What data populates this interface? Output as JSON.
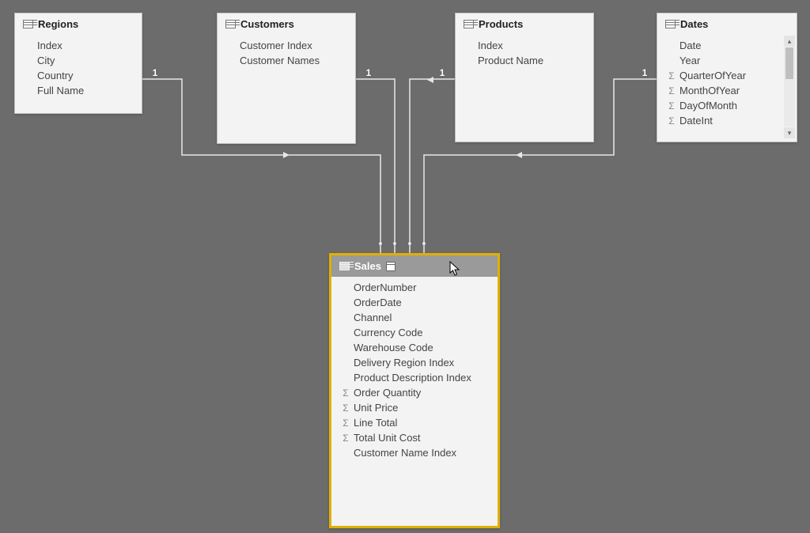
{
  "tables": {
    "regions": {
      "title": "Regions",
      "fields": [
        "Index",
        "City",
        "Country",
        "Full Name"
      ]
    },
    "customers": {
      "title": "Customers",
      "fields": [
        "Customer Index",
        "Customer Names"
      ]
    },
    "products": {
      "title": "Products",
      "fields": [
        "Index",
        "Product Name"
      ]
    },
    "dates": {
      "title": "Dates",
      "fields": [
        {
          "name": "Date"
        },
        {
          "name": "Year"
        },
        {
          "name": "QuarterOfYear",
          "sigma": true
        },
        {
          "name": "MonthOfYear",
          "sigma": true
        },
        {
          "name": "DayOfMonth",
          "sigma": true
        },
        {
          "name": "DateInt",
          "sigma": true
        }
      ]
    },
    "sales": {
      "title": "Sales",
      "fields": [
        {
          "name": "OrderNumber"
        },
        {
          "name": "OrderDate"
        },
        {
          "name": "Channel"
        },
        {
          "name": "Currency Code"
        },
        {
          "name": "Warehouse Code"
        },
        {
          "name": "Delivery Region Index"
        },
        {
          "name": "Product Description Index"
        },
        {
          "name": "Order Quantity",
          "sigma": true
        },
        {
          "name": "Unit Price",
          "sigma": true
        },
        {
          "name": "Line Total",
          "sigma": true
        },
        {
          "name": "Total Unit Cost",
          "sigma": true
        },
        {
          "name": "Customer Name Index"
        }
      ]
    }
  },
  "relationships": {
    "one": "1",
    "many": "*"
  }
}
